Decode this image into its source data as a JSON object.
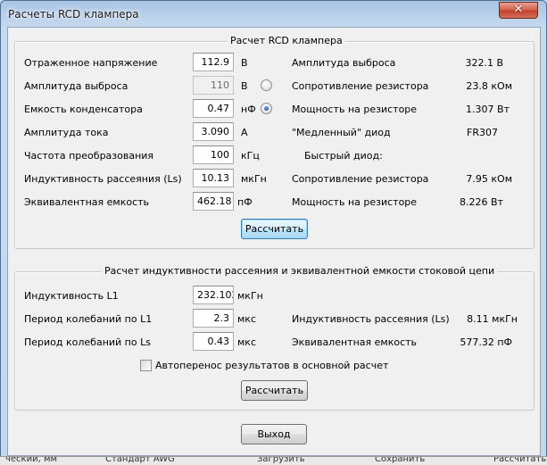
{
  "window": {
    "title": "Расчеты RCD клампера",
    "close_glyph": "✕"
  },
  "rcd": {
    "title": "Расчет RCD клампера",
    "inputs": {
      "reflected_voltage": {
        "label": "Отраженное напряжение",
        "value": "112.9",
        "unit": "В"
      },
      "spike_amplitude": {
        "label": "Амплитуда выброса",
        "value": "110",
        "unit": "В"
      },
      "capacitor": {
        "label": "Емкость конденсатора",
        "value": "0.47",
        "unit": "нФ"
      },
      "current_amplitude": {
        "label": "Амплитуда тока",
        "value": "3.090",
        "unit": "А"
      },
      "frequency": {
        "label": "Частота преобразования",
        "value": "100",
        "unit": "кГц"
      },
      "leakage_inductance": {
        "label": "Индуктивность рассеяния (Ls)",
        "value": "10.13",
        "unit": "мкГн"
      },
      "equivalent_capacitance": {
        "label": "Эквивалентная емкость",
        "value": "462.18",
        "unit": "пФ"
      }
    },
    "results": {
      "spike_amplitude": {
        "label": "Амплитуда выброса",
        "value": "322.1 В"
      },
      "resistor": {
        "label": "Сопротивление резистора",
        "value": "23.8 кОм"
      },
      "resistor_power": {
        "label": "Мощность на резисторе",
        "value": "1.307 Вт"
      },
      "slow_diode": {
        "label": "\"Медленный\" диод",
        "value": "FR307"
      },
      "fast_diode": {
        "label": "Быстрый диод:"
      },
      "fast_resistor": {
        "label": "Сопротивление резистора",
        "value": "7.95 кОм"
      },
      "fast_power": {
        "label": "Мощность на резисторе",
        "value": "8.226 Вт"
      }
    },
    "calc_button": "Рассчитать"
  },
  "leakage": {
    "title": "Расчет индуктивности рассеяния и эквивалентной емкости стоковой цепи",
    "inputs": {
      "l1": {
        "label": "Индуктивность L1",
        "value": "232.102",
        "unit": "мкГн"
      },
      "period_l1": {
        "label": "Период колебаний по L1",
        "value": "2.3",
        "unit": "мкс"
      },
      "period_ls": {
        "label": "Период колебаний по Ls",
        "value": "0.43",
        "unit": "мкс"
      }
    },
    "results": {
      "leakage": {
        "label": "Индуктивность рассеяния (Ls)",
        "value": "8.11 мкГн"
      },
      "capacitance": {
        "label": "Эквивалентная емкость",
        "value": "577.32 пФ"
      }
    },
    "autotransfer": {
      "label": "Автоперенос результатов в основной расчет",
      "checked": false
    },
    "calc_button": "Рассчитать"
  },
  "exit_button": "Выход",
  "taskbar": {
    "item1": "ческий, мм",
    "item2": "Стандарт AWG",
    "item3": "Загрузить",
    "item4": "Сохранить",
    "item5": "Рассчитать"
  }
}
